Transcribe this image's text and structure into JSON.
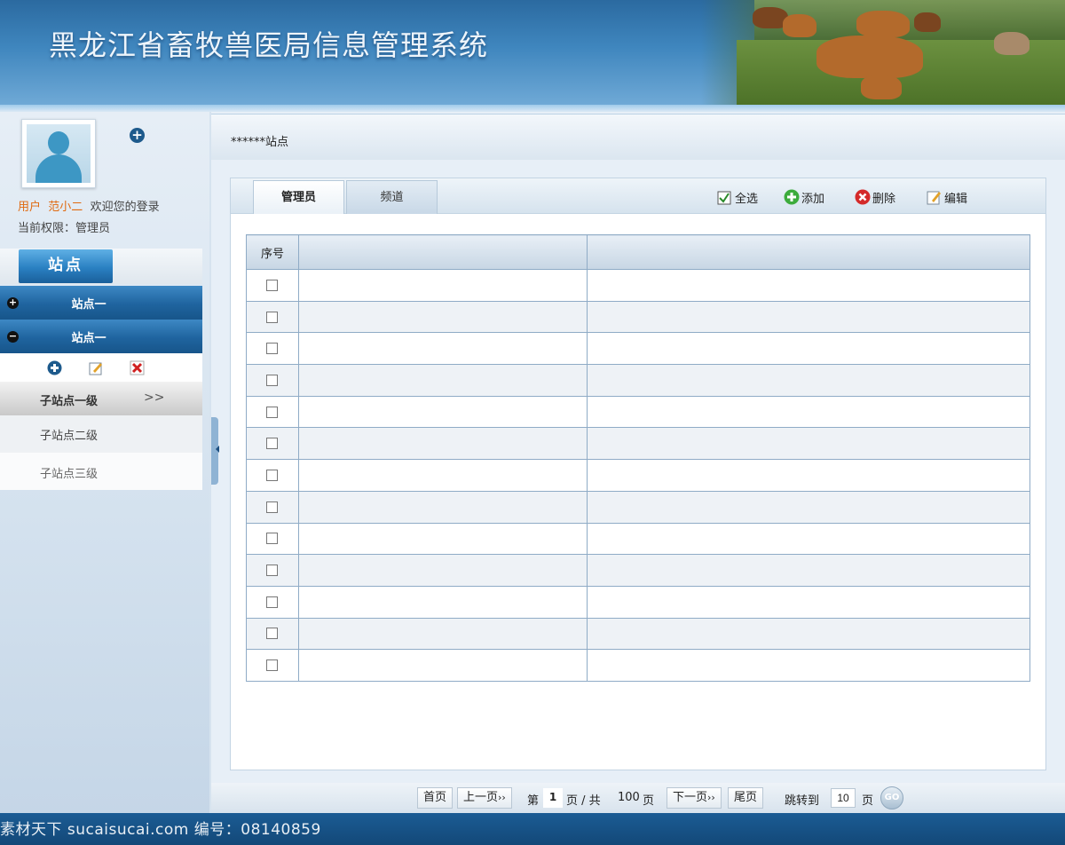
{
  "header": {
    "title": "黑龙江省畜牧兽医局信息管理系统"
  },
  "user": {
    "user_prefix": "用户",
    "user_name": "范小二",
    "welcome": "欢迎您的登录",
    "permission": "当前权限：管理员"
  },
  "sidebar": {
    "site_tab_label": "站点",
    "menu_items": [
      {
        "label": "站点一",
        "state": "collapsed"
      },
      {
        "label": "站点一",
        "state": "expanded"
      }
    ],
    "sub_items": [
      {
        "label": "子站点一级",
        "arrow": ">>"
      },
      {
        "label": "子站点二级"
      },
      {
        "label": "子站点三级"
      }
    ]
  },
  "main": {
    "breadcrumb": "******站点",
    "tabs": [
      {
        "label": "管理员",
        "active": true
      },
      {
        "label": "频道",
        "active": false
      }
    ],
    "actions": {
      "select_all": "全选",
      "add": "添加",
      "delete": "删除",
      "edit": "编辑"
    },
    "table": {
      "headers": [
        "序号",
        "",
        ""
      ],
      "row_count": 13
    }
  },
  "pager": {
    "first": "首页",
    "prev": "上一页",
    "prev_arrow": "››",
    "page_prefix": "第",
    "current_page": "1",
    "page_mid": "页 / 共",
    "total_pages": "100",
    "page_suffix": "页",
    "next": "下一页",
    "next_arrow": "››",
    "last": "尾页",
    "jump_label": "跳转到",
    "jump_value": "10",
    "jump_suffix": "页",
    "go": "GO"
  },
  "footer": {
    "watermark": "素材天下 sucaisucai.com   编号：08140859"
  },
  "colors": {
    "header_blue": "#2b6aa0",
    "menu_blue": "#1f649f",
    "footer_blue": "#134878",
    "accent_orange": "#e06a10"
  }
}
